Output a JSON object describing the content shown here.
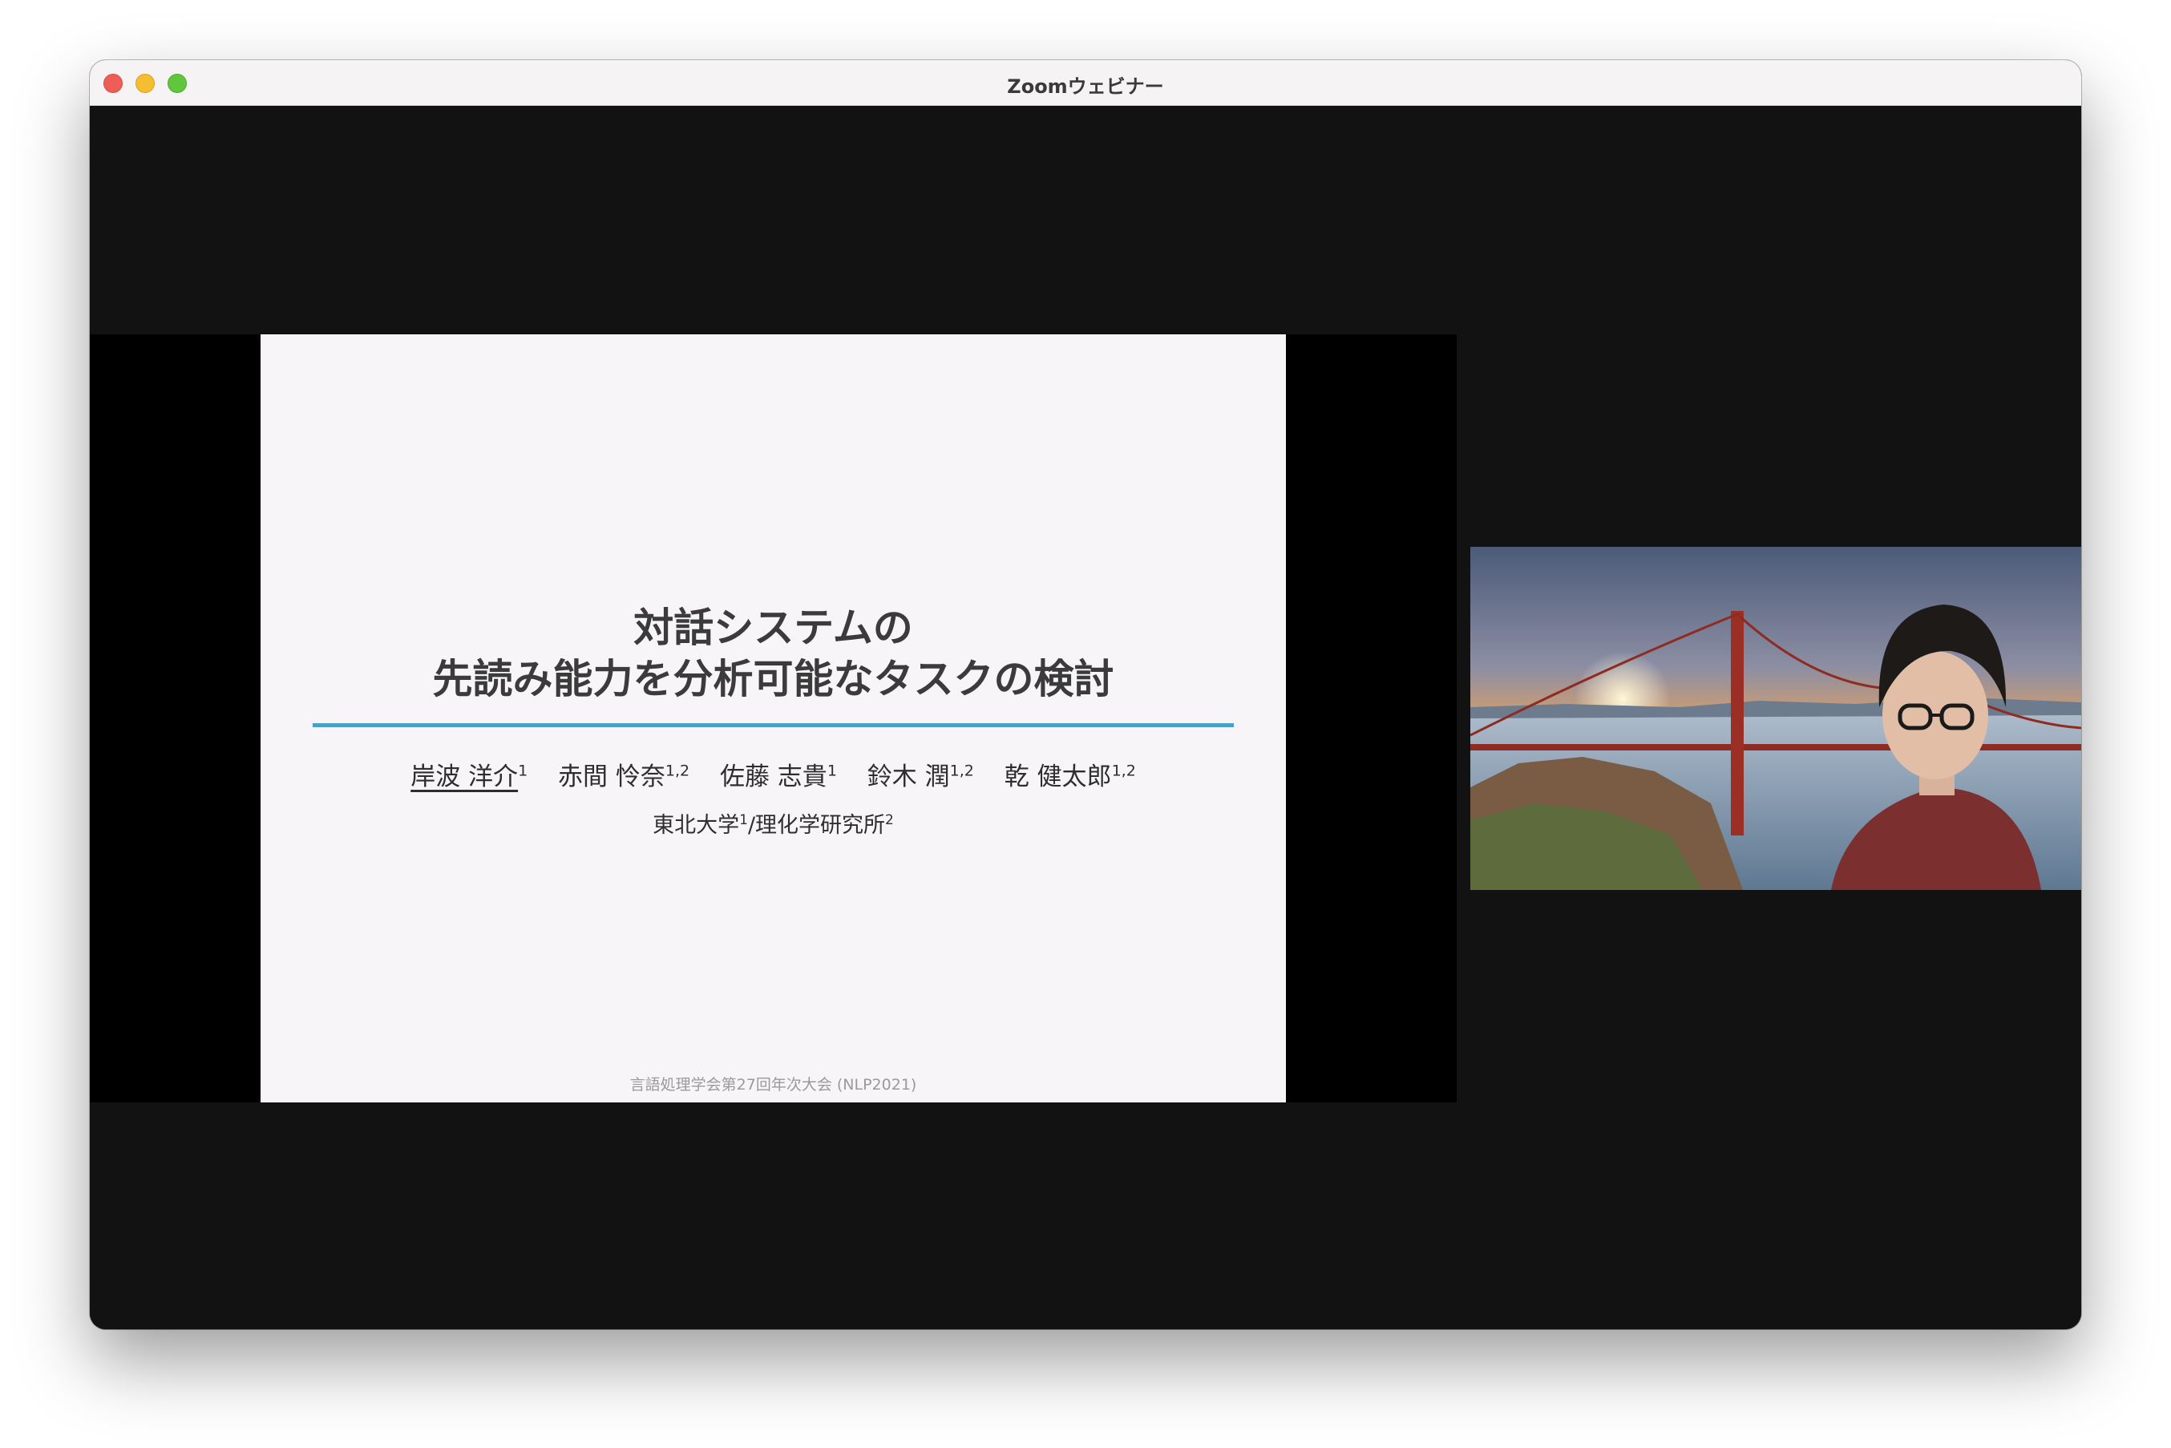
{
  "window": {
    "title": "Zoomウェビナー"
  },
  "slide": {
    "title_lines": [
      "対話システムの",
      "先読み能力を分析可能なタスクの検討"
    ],
    "authors": [
      {
        "name": "岸波 洋介",
        "affil": "1"
      },
      {
        "name": "赤間 怜奈",
        "affil": "1,2"
      },
      {
        "name": "佐藤 志貴",
        "affil": "1"
      },
      {
        "name": "鈴木 潤",
        "affil": "1,2"
      },
      {
        "name": "乾 健太郎",
        "affil": "1,2"
      }
    ],
    "affiliations": [
      {
        "name": "東北大学",
        "mark": "1"
      },
      {
        "name": "理化学研究所",
        "mark": "2"
      }
    ],
    "affiliation_separator": "/",
    "footer": "言語処理学会第27回年次大会 (NLP2021)"
  },
  "colors": {
    "slide_accent_rule": "#4a9fc7",
    "window_background": "#121212",
    "slide_background": "#f7f5f8"
  }
}
